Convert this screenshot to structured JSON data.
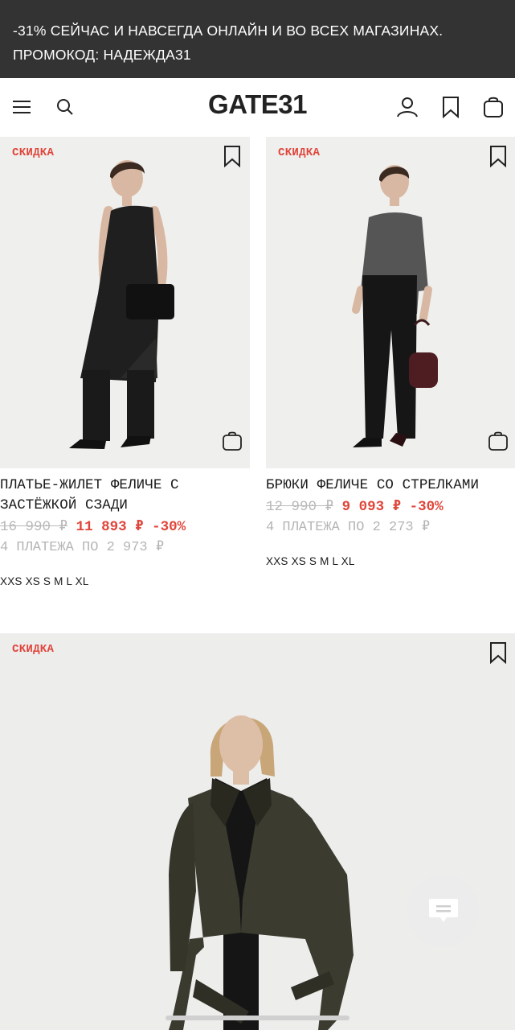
{
  "promo": {
    "line1": "-31% СЕЙЧАС И НАВСЕГДА ОНЛАЙН И ВО ВСЕХ МАГАЗИНАХ.",
    "line2": "ПРОМОКОД: НАДЕЖДА31"
  },
  "header": {
    "logo": "GATE31",
    "icons": [
      "menu-icon",
      "search-icon",
      "account-icon",
      "bookmark-icon",
      "bag-icon"
    ]
  },
  "products": [
    {
      "badge": "СКИДКА",
      "name": "ПЛАТЬЕ-ЖИЛЕТ ФЕЛИЧЕ С ЗАСТЁЖКОЙ СЗАДИ",
      "name_line1": "ПЛАТЬЕ-ЖИЛЕТ ФЕЛИЧЕ С",
      "name_line2": "ЗАСТЁЖКОЙ СЗАДИ",
      "old_price": "16 990 ₽",
      "new_price": "11 893 ₽",
      "discount": "-30%",
      "installment": "4 ПЛАТЕЖА ПО 2 973 ₽",
      "sizes": "XXS XS S M L XL"
    },
    {
      "badge": "СКИДКА",
      "name": "БРЮКИ ФЕЛИЧЕ СО СТРЕЛКАМИ",
      "old_price": "12 990 ₽",
      "new_price": "9 093 ₽",
      "discount": "-30%",
      "installment": "4 ПЛАТЕЖА ПО 2 273 ₽",
      "sizes": "XXS XS S M L XL"
    },
    {
      "badge": "СКИДКА"
    }
  ],
  "colors": {
    "promo_bg": "#333333",
    "accent_red": "#e0453a",
    "muted_gray": "#b8b8b8",
    "image_bg": "#efefed"
  }
}
